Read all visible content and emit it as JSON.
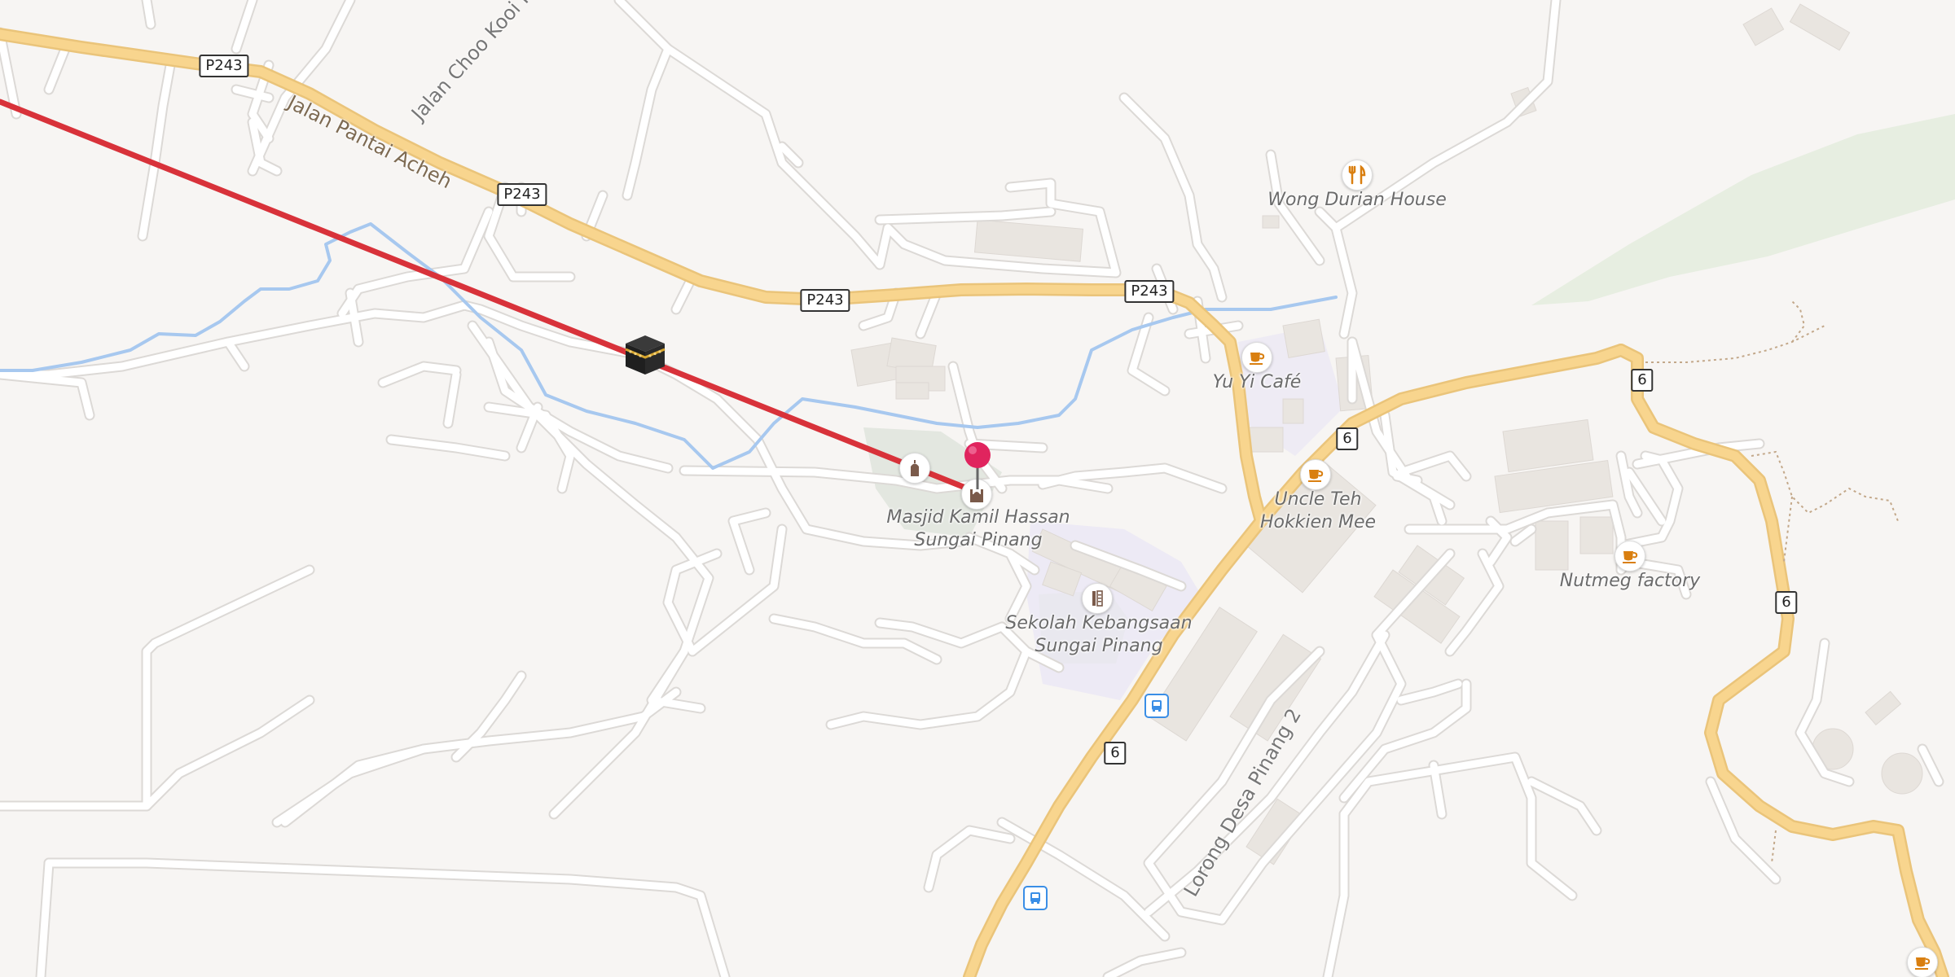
{
  "shields": {
    "p243_a": "P243",
    "p243_b": "P243",
    "p243_c": "P243",
    "p243_d": "P243",
    "r6_a": "6",
    "r6_b": "6",
    "r6_c": "6",
    "r6_d": "6"
  },
  "roads": {
    "jalan_pantai_acheh": "Jalan Pantai Acheh",
    "jalan_choo_kooi_kheng": "Jalan Choo Kooi Kheng",
    "lorong_desa_pinang_2": "Lorong Desa Pinang 2"
  },
  "pois": {
    "wong_durian_house": "Wong Durian House",
    "yu_yi_cafe": "Yu Yi Café",
    "uncle_teh_line1": "Uncle Teh",
    "uncle_teh_line2": "Hokkien Mee",
    "nutmeg_factory": "Nutmeg factory",
    "masjid_line1": "Masjid Kamil Hassan",
    "masjid_line2": "Sungai Pinang",
    "sekolah_line1": "Sekolah Kebangsaan",
    "sekolah_line2": "Sungai Pinang"
  },
  "icons": {
    "cafe": "coffee-cup-icon",
    "restaurant": "fork-knife-icon",
    "mosque": "mosque-icon",
    "school": "school-icon",
    "bus": "bus-stop-icon",
    "kaaba": "kaaba-icon",
    "pin": "location-pin-icon"
  },
  "colors": {
    "background": "#f7f5f3",
    "major_road": "#f8d58e",
    "major_road_casing": "#eac47a",
    "minor_road": "#ffffff",
    "minor_road_casing": "#dcd9d6",
    "river": "#a7c8ef",
    "qibla_line": "#d8323a",
    "pin": "#e0245e",
    "poi_orange": "#d97f10",
    "bus_blue": "#3a8ee6"
  }
}
